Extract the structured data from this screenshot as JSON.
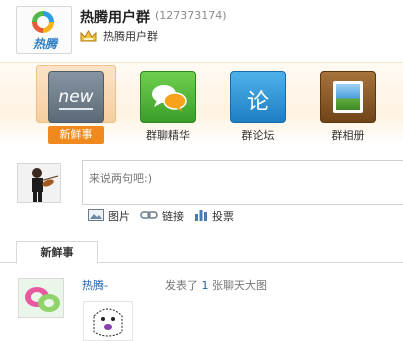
{
  "header": {
    "group_name": "热腾用户群",
    "group_id": "(127373174)",
    "owner_name": "热腾用户群",
    "logo_text": "热腾"
  },
  "tabs": [
    {
      "label": "新鲜事",
      "tile_text": "new",
      "icon": "new-tile-icon",
      "active": true
    },
    {
      "label": "群聊精华",
      "icon": "chat-bubbles-icon",
      "active": false
    },
    {
      "label": "群论坛",
      "tile_text": "论",
      "icon": "forum-icon",
      "active": false
    },
    {
      "label": "群相册",
      "icon": "photo-album-icon",
      "active": false
    }
  ],
  "composer": {
    "placeholder": "来说两句吧:)",
    "attachments": [
      {
        "label": "图片",
        "icon": "image-icon"
      },
      {
        "label": "链接",
        "icon": "link-icon"
      },
      {
        "label": "投票",
        "icon": "poll-icon"
      }
    ]
  },
  "feed": {
    "tab_label": "新鲜事",
    "items": [
      {
        "user": "热腾-",
        "action_prefix": "发表了",
        "count": "1",
        "action_suffix": "张聊天大图"
      }
    ]
  },
  "colors": {
    "accent_orange": "#f08a1e",
    "link_blue": "#1f5fa8"
  }
}
